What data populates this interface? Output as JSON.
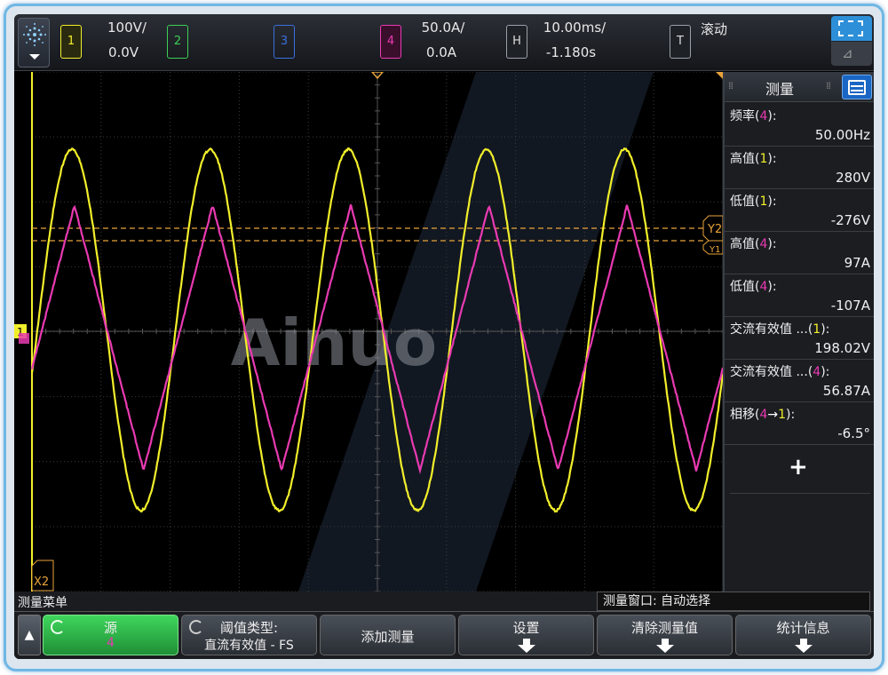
{
  "channels": {
    "ch1": {
      "label": "1",
      "scale": "100V/",
      "offset": "0.0V",
      "color": "#f2ef2b"
    },
    "ch2": {
      "label": "2",
      "color": "#3ecf55"
    },
    "ch3": {
      "label": "3",
      "color": "#3b6fe0"
    },
    "ch4": {
      "label": "4",
      "scale": "50.0A/",
      "offset": "0.0A",
      "color": "#e93ab2"
    }
  },
  "horizontal": {
    "label": "H",
    "scale": "10.00ms/",
    "delay": "-1.180s"
  },
  "trigger": {
    "label": "T",
    "mode": "滚动"
  },
  "watermark": "Ainuo",
  "cursor_labels": {
    "y2": "Y2",
    "y1": "Y1",
    "x2": "X2"
  },
  "measure_panel": {
    "title": "测量",
    "items": [
      {
        "name": "频率",
        "src": "4",
        "value": "50.00Hz"
      },
      {
        "name": "高值",
        "src": "1",
        "value": "280V"
      },
      {
        "name": "低值",
        "src": "1",
        "value": "-276V"
      },
      {
        "name": "高值",
        "src": "4",
        "value": "97A"
      },
      {
        "name": "低值",
        "src": "4",
        "value": "-107A"
      },
      {
        "name": "交流有效值 ...",
        "src": "1",
        "value": "198.02V"
      },
      {
        "name": "交流有效值 ...",
        "src": "4",
        "value": "56.87A"
      },
      {
        "name": "相移",
        "src": "4→1",
        "value": "-6.5°"
      }
    ],
    "add_symbol": "+"
  },
  "softkeys": {
    "menu_title": "测量菜单",
    "window_title": "测量窗口: 自动选择",
    "source_label": "源",
    "source_value": "4",
    "threshold_label": "阈值类型:",
    "threshold_value": "直流有效值 - FS",
    "add_measure": "添加测量",
    "settings": "设置",
    "clear": "清除测量值",
    "stats": "统计信息"
  },
  "waveforms": {
    "frequency_hz": 50,
    "time_per_div_ms": 10,
    "divisions": 10,
    "ch1": {
      "type": "sine",
      "high": 280,
      "low": -276,
      "volts_per_div": 100
    },
    "ch4": {
      "type": "triangle",
      "high": 97,
      "low": -107,
      "amps_per_div": 50,
      "phase_deg": -6.5
    }
  }
}
